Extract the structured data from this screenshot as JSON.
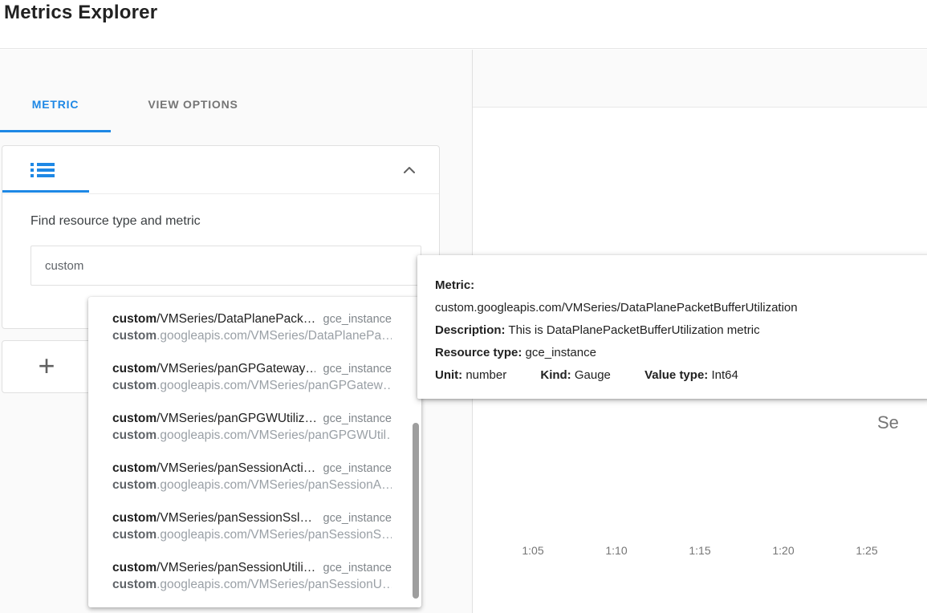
{
  "page": {
    "title": "Metrics Explorer"
  },
  "tabs": {
    "metric": "METRIC",
    "view_options": "VIEW OPTIONS"
  },
  "metric_card": {
    "find_label": "Find resource type and metric",
    "search_value": "custom"
  },
  "icons": {
    "metric_list": "list-icon",
    "collapse": "chevron-up-icon",
    "add_plus_glyph": "+"
  },
  "dropdown_items": [
    {
      "name_bold": "custom",
      "name_rest": "/VMSeries/DataPlanePack…",
      "resource": "gce_instance",
      "path_bold": "custom",
      "path_rest": ".googleapis.com/VMSeries/DataPlanePa…"
    },
    {
      "name_bold": "custom",
      "name_rest": "/VMSeries/panGPGateway…",
      "resource": "gce_instance",
      "path_bold": "custom",
      "path_rest": ".googleapis.com/VMSeries/panGPGatew…"
    },
    {
      "name_bold": "custom",
      "name_rest": "/VMSeries/panGPGWUtiliz…",
      "resource": "gce_instance",
      "path_bold": "custom",
      "path_rest": ".googleapis.com/VMSeries/panGPGWUtil…"
    },
    {
      "name_bold": "custom",
      "name_rest": "/VMSeries/panSessionActi…",
      "resource": "gce_instance",
      "path_bold": "custom",
      "path_rest": ".googleapis.com/VMSeries/panSessionA…"
    },
    {
      "name_bold": "custom",
      "name_rest": "/VMSeries/panSessionSsl…",
      "resource": "gce_instance",
      "path_bold": "custom",
      "path_rest": ".googleapis.com/VMSeries/panSessionS…"
    },
    {
      "name_bold": "custom",
      "name_rest": "/VMSeries/panSessionUtili…",
      "resource": "gce_instance",
      "path_bold": "custom",
      "path_rest": ".googleapis.com/VMSeries/panSessionU…"
    }
  ],
  "tooltip": {
    "metric_label": "Metric:",
    "metric_value": "custom.googleapis.com/VMSeries/DataPlanePacketBufferUtilization",
    "description_label": "Description:",
    "description_value": "This is DataPlanePacketBufferUtilization metric",
    "resource_type_label": "Resource type:",
    "resource_type_value": "gce_instance",
    "unit_label": "Unit:",
    "unit_value": "number",
    "kind_label": "Kind:",
    "kind_value": "Gauge",
    "value_type_label": "Value type:",
    "value_type_value": "Int64"
  },
  "chart": {
    "x_ticks": [
      "1:05",
      "1:10",
      "1:15",
      "1:20",
      "1:25"
    ],
    "clipped_text": "Se"
  },
  "colors": {
    "accent": "#1E88E5",
    "panel_bg": "#FAFAFA",
    "border": "#E0E0E0",
    "text_primary": "#212121",
    "text_secondary": "#757575",
    "text_muted": "#9AA0A6",
    "resource_label": "#80868B",
    "scrollbar_thumb": "#9E9E9E"
  }
}
